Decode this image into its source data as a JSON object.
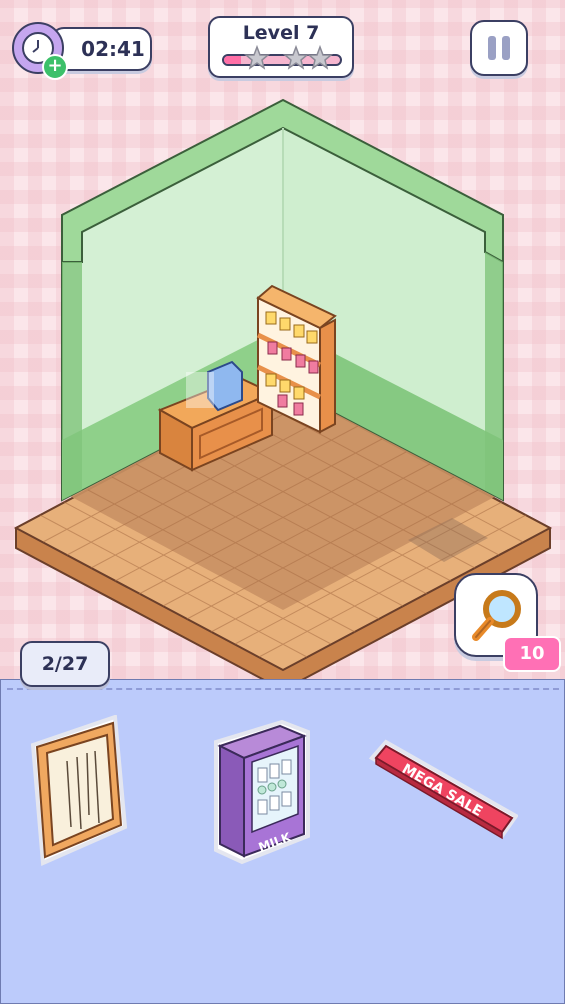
{
  "hud": {
    "timer": "02:41",
    "level_label": "Level 7",
    "level_progress": 0.15,
    "stars_earned": 0,
    "stars_total": 3
  },
  "counter": "2/27",
  "hint": {
    "count": "10",
    "icon": "magnifier-icon"
  },
  "tray": {
    "items": [
      {
        "name": "wooden-window-frame"
      },
      {
        "name": "milk-fridge",
        "label": "MILK"
      },
      {
        "name": "mega-sale-sign",
        "label": "MEGA SALE"
      }
    ]
  },
  "colors": {
    "wall": "#d4f0d4",
    "wall_trim": "#8fd08a",
    "floor": "#d89a62",
    "tray": "#bccbfb",
    "accent_pink": "#ff70b5"
  }
}
